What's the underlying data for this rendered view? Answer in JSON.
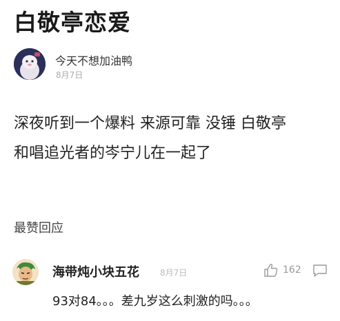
{
  "page": {
    "title": "白敬亭恋爱"
  },
  "post": {
    "author": "今天不想加油鸭",
    "date": "8月7日",
    "avatar_icon": "cartoon-character-avatar",
    "body_lines": [
      "深夜听到一个爆料 来源可靠 没锤 白敬亭",
      "和唱追光者的岑宁儿在一起了"
    ]
  },
  "comments_section": {
    "title": "最赞回应"
  },
  "comment": {
    "author": "海带炖小块五花",
    "date": "8月7日",
    "avatar_icon": "anime-character-avatar",
    "likes": "162",
    "like_icon": "thumbs-up-icon",
    "reply_icon": "comment-bubble-icon",
    "text": "93对84。。。差九岁这么刺激的吗。。。"
  },
  "colors": {
    "title": "#1a1a1a",
    "body_text": "#222222",
    "muted": "#aaaaaa",
    "icon": "#999999"
  }
}
